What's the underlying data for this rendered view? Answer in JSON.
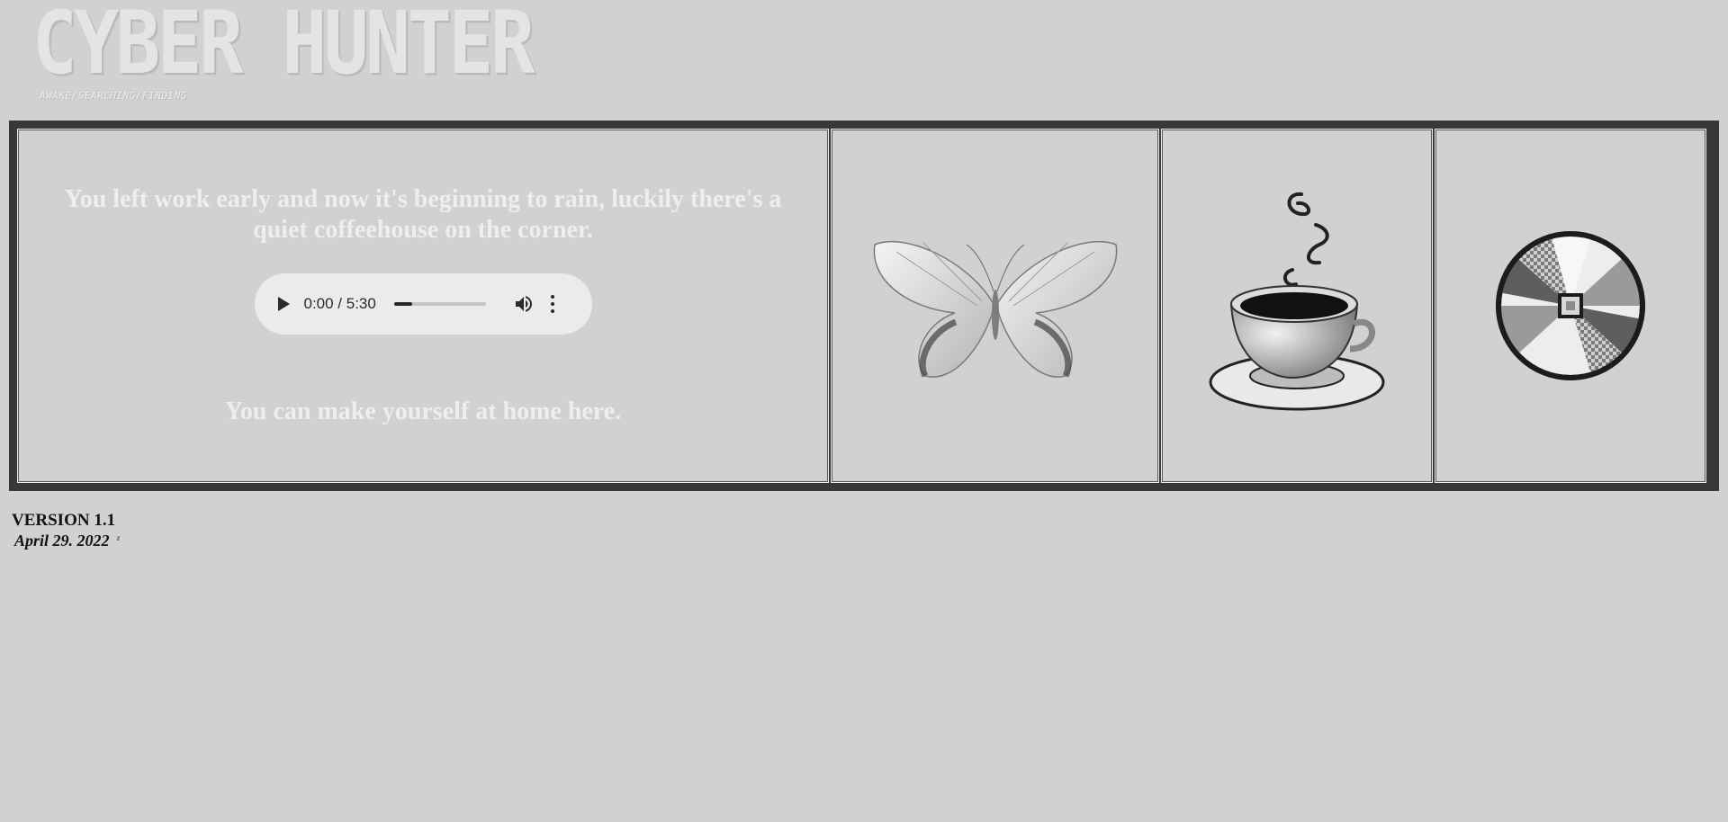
{
  "header": {
    "title": "CYBER HUNTER",
    "subtitle": "AWAKE/SEARCHING/FINDING"
  },
  "main": {
    "lead_text": "You left work early and now it's beginning to rain, luckily there's a quiet coffeehouse on the corner.",
    "tagline": "You can make yourself at home here.",
    "audio_player": {
      "current_time": "0:00",
      "duration": "5:30",
      "time_display": "0:00 / 5:30",
      "progress_fraction": 0.2
    },
    "images": [
      {
        "icon": "butterfly-image"
      },
      {
        "icon": "coffee-cup-image"
      },
      {
        "icon": "cd-disc-image"
      }
    ]
  },
  "footer": {
    "version": "VERSION 1.1",
    "date": "April 29. 2022",
    "mark": "²"
  },
  "colors": {
    "background": "#d1d1d1",
    "frame": "#383838",
    "text_light": "#eeeeee",
    "text_dark": "#111111"
  }
}
